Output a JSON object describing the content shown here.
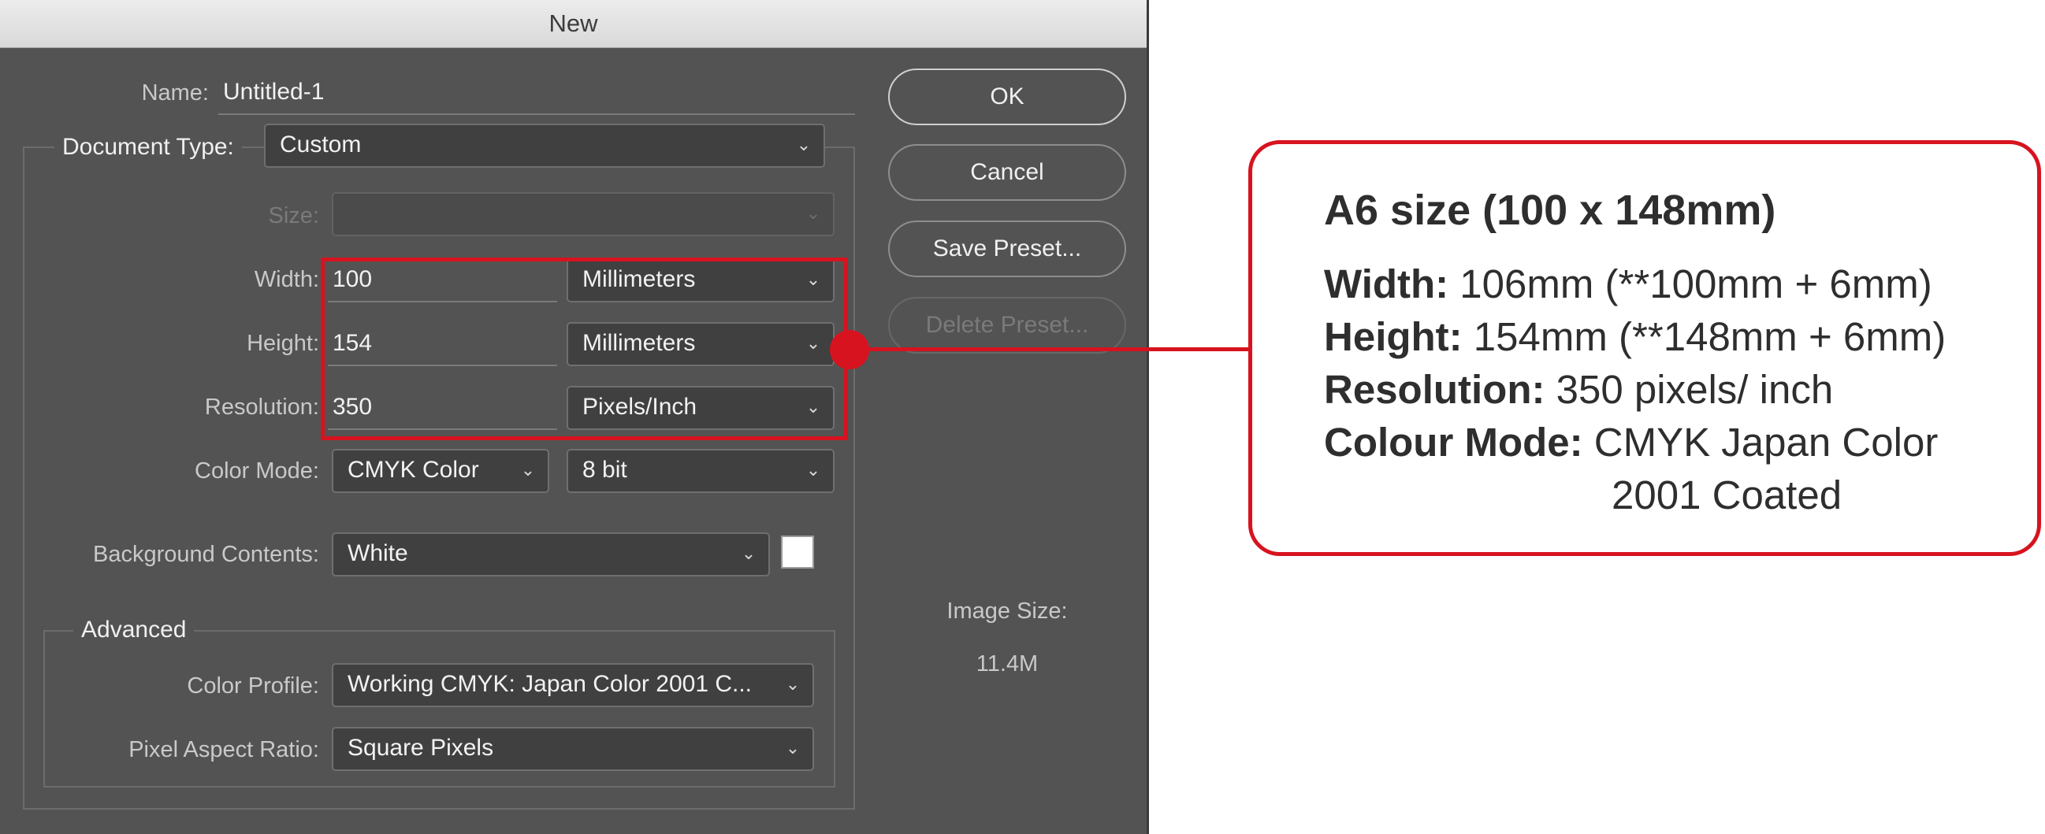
{
  "dialog": {
    "title": "New",
    "name_label": "Name:",
    "name_value": "Untitled-1",
    "document_type_label": "Document Type:",
    "document_type_value": "Custom",
    "size_label": "Size:",
    "size_value": "",
    "width_label": "Width:",
    "width_value": "100",
    "width_unit": "Millimeters",
    "height_label": "Height:",
    "height_value": "154",
    "height_unit": "Millimeters",
    "resolution_label": "Resolution:",
    "resolution_value": "350",
    "resolution_unit": "Pixels/Inch",
    "color_mode_label": "Color Mode:",
    "color_mode_value": "CMYK Color",
    "bit_depth_value": "8 bit",
    "background_label": "Background Contents:",
    "background_value": "White",
    "advanced_label": "Advanced",
    "color_profile_label": "Color Profile:",
    "color_profile_value": "Working CMYK:  Japan Color 2001 C...",
    "pixel_aspect_label": "Pixel Aspect Ratio:",
    "pixel_aspect_value": "Square Pixels",
    "buttons": {
      "ok": "OK",
      "cancel": "Cancel",
      "save_preset": "Save Preset...",
      "delete_preset": "Delete Preset..."
    },
    "image_size_label": "Image Size:",
    "image_size_value": "11.4M"
  },
  "callout": {
    "title": "A6 size (100 x 148mm)",
    "width_key": "Width:",
    "width_text": " 106mm (**100mm + 6mm)",
    "height_key": "Height:",
    "height_text": " 154mm (**148mm + 6mm)",
    "resolution_key": "Resolution:",
    "resolution_text": " 350 pixels/ inch",
    "colour_mode_key": "Colour Mode:",
    "colour_mode_text": " CMYK Japan Color",
    "colour_mode_text_2": "2001 Coated"
  },
  "colors": {
    "dialog_bg": "#535353",
    "accent_red": "#d7131f",
    "swatch": "#ffffff"
  },
  "icons": {
    "dropdown": "chevron-down-icon"
  }
}
